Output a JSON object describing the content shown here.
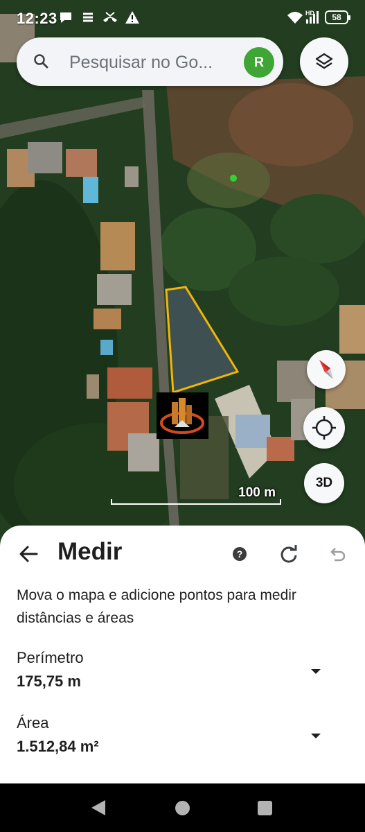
{
  "status_bar": {
    "time": "12:23",
    "network_label": "HD",
    "battery": "58"
  },
  "search": {
    "placeholder": "Pesquisar no Go...",
    "avatar_letter": "R",
    "avatar_color": "#3fa535"
  },
  "map": {
    "scale_label": "100 m",
    "measure_outline_color": "#f2b705",
    "view_mode_label": "3D",
    "icons": [
      "layers-icon",
      "compass-icon",
      "my-location-icon"
    ]
  },
  "measure_panel": {
    "title": "Medir",
    "instructions": "Mova o mapa e adicione pontos para medir distâncias e áreas",
    "perimeter_label": "Perímetro",
    "perimeter_value": "175,75 m",
    "area_label": "Área",
    "area_value": "1.512,84 m²",
    "help_glyph": "?",
    "icons": [
      "back-arrow-icon",
      "help-icon",
      "reset-icon",
      "undo-icon",
      "chevron-down-icon"
    ]
  },
  "nav_bar": {
    "icons": [
      "nav-back-icon",
      "nav-home-icon",
      "nav-recents-icon"
    ]
  }
}
